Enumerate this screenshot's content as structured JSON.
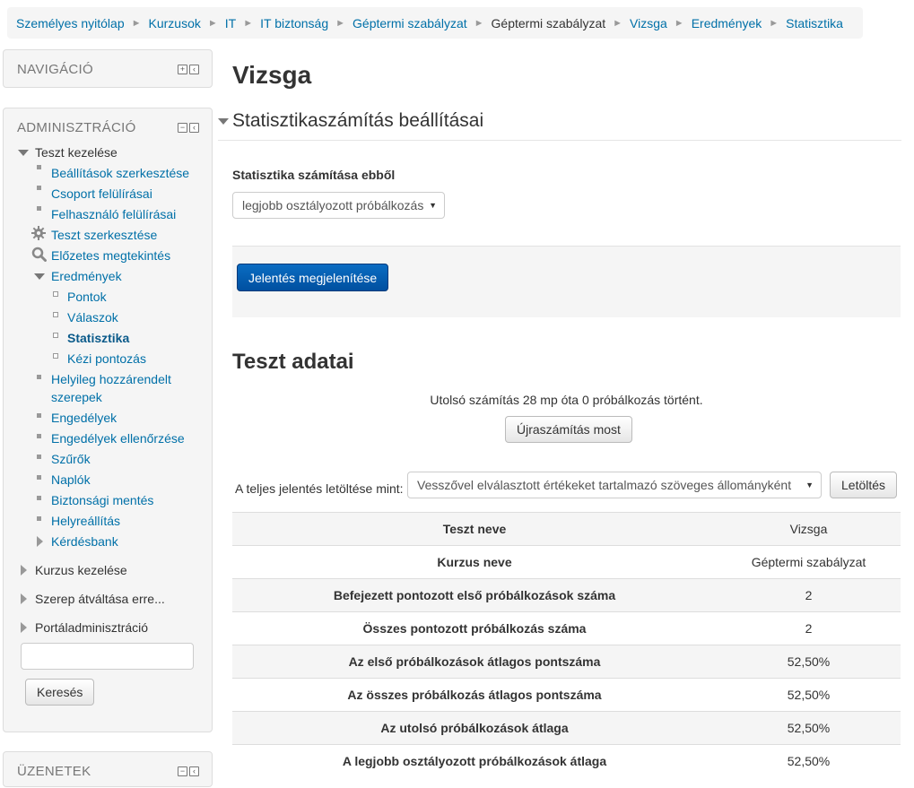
{
  "breadcrumb": [
    "Személyes nyitólap",
    "Kurzusok",
    "IT",
    "IT biztonság",
    "Géptermi szabályzat",
    "Géptermi szabályzat",
    "Vizsga",
    "Eredmények",
    "Statisztika"
  ],
  "nav_block": {
    "title": "NAVIGÁCIÓ"
  },
  "admin_block": {
    "title": "ADMINISZTRÁCIÓ",
    "quiz_admin": "Teszt kezelése",
    "items": {
      "edit_settings": "Beállítások szerkesztése",
      "group_overrides": "Csoport felülírásai",
      "user_overrides": "Felhasználó felülírásai",
      "edit_quiz": "Teszt szerkesztése",
      "preview": "Előzetes megtekintés",
      "results": "Eredmények",
      "grades": "Pontok",
      "responses": "Válaszok",
      "statistics": "Statisztika",
      "manual_grading": "Kézi pontozás",
      "local_roles_1": "Helyileg hozzárendelt",
      "local_roles_2": "szerepek",
      "permissions": "Engedélyek",
      "check_permissions": "Engedélyek ellenőrzése",
      "filters": "Szűrők",
      "logs": "Naplók",
      "backup": "Biztonsági mentés",
      "restore": "Helyreállítás",
      "question_bank": "Kérdésbank",
      "course_admin": "Kurzus kezelése",
      "switch_role": "Szerep átváltása erre...",
      "site_admin": "Portáladminisztráció"
    },
    "search_value": "",
    "search_button": "Keresés"
  },
  "messages_block": {
    "title": "ÜZENETEK"
  },
  "page_title": "Vizsga",
  "settings_legend": "Statisztikaszámítás beállításai",
  "calc_from_label": "Statisztika számítása ebből",
  "calc_from_value": "legjobb osztályozott próbálkozás",
  "show_report_button": "Jelentés megjelenítése",
  "section_title": "Teszt adatai",
  "calc_info": "Utolsó számítás 28 mp óta 0 próbálkozás történt.",
  "recalc_button": "Újraszámítás most",
  "download_label": "A teljes jelentés letöltése mint:",
  "download_format": "Vesszővel elválasztott értékeket tartalmazó szöveges állományként",
  "download_button": "Letöltés",
  "stats": [
    {
      "key": "Teszt neve",
      "value": "Vizsga"
    },
    {
      "key": "Kurzus neve",
      "value": "Géptermi szabályzat"
    },
    {
      "key": "Befejezett pontozott első próbálkozások száma",
      "value": "2"
    },
    {
      "key": "Összes pontozott próbálkozás száma",
      "value": "2"
    },
    {
      "key": "Az első próbálkozások átlagos pontszáma",
      "value": "52,50%"
    },
    {
      "key": "Az összes próbálkozás átlagos pontszáma",
      "value": "52,50%"
    },
    {
      "key": "Az utolsó próbálkozások átlaga",
      "value": "52,50%"
    },
    {
      "key": "A legjobb osztályozott próbálkozások átlaga",
      "value": "52,50%"
    }
  ]
}
